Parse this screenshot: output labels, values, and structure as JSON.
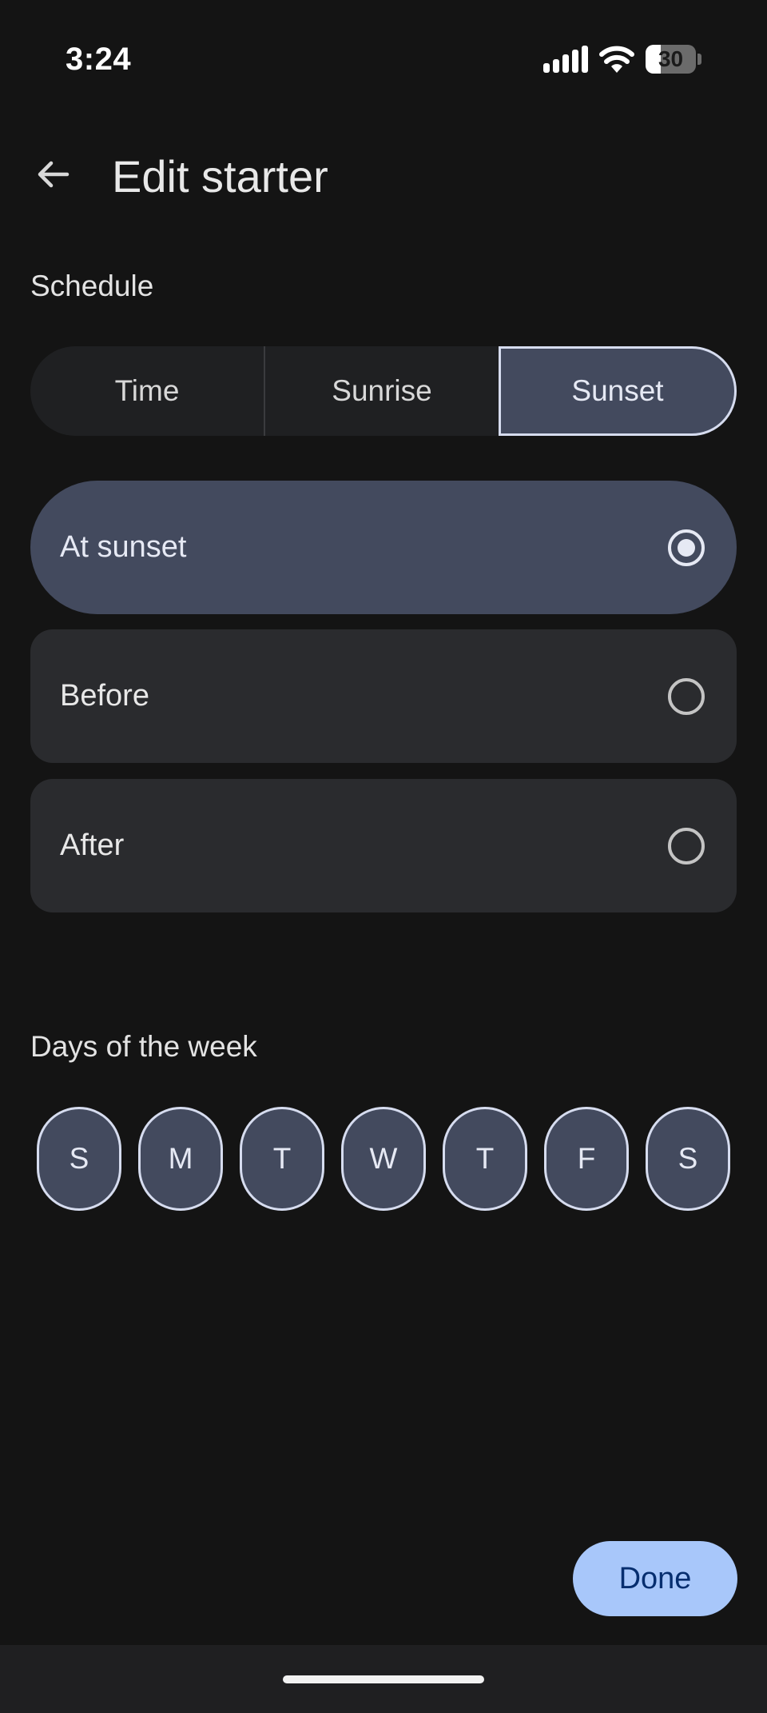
{
  "status_bar": {
    "time": "3:24",
    "battery": "30",
    "battery_level": 0.3
  },
  "header": {
    "title": "Edit starter",
    "back_icon": "arrow-back-icon"
  },
  "schedule": {
    "heading": "Schedule",
    "segments": [
      {
        "label": "Time",
        "selected": false
      },
      {
        "label": "Sunrise",
        "selected": false
      },
      {
        "label": "Sunset",
        "selected": true
      }
    ],
    "options": [
      {
        "label": "At sunset",
        "selected": true
      },
      {
        "label": "Before",
        "selected": false
      },
      {
        "label": "After",
        "selected": false
      }
    ]
  },
  "days": {
    "heading": "Days of the week",
    "items": [
      {
        "label": "S",
        "selected": true
      },
      {
        "label": "M",
        "selected": true
      },
      {
        "label": "T",
        "selected": true
      },
      {
        "label": "W",
        "selected": true
      },
      {
        "label": "T",
        "selected": true
      },
      {
        "label": "F",
        "selected": true
      },
      {
        "label": "S",
        "selected": true
      }
    ]
  },
  "actions": {
    "done_label": "Done"
  },
  "colors": {
    "background": "#141414",
    "selected_fill": "#434a5e",
    "selected_border": "#d6dcef",
    "option_fill": "#2a2b2e",
    "primary_button": "#a8c7fa",
    "primary_button_text": "#062e6f"
  }
}
